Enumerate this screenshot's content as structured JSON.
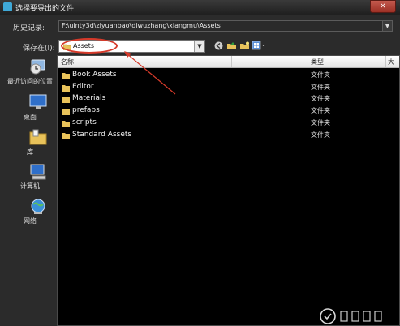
{
  "window": {
    "title": "选择要导出的文件",
    "close_symbol": "×"
  },
  "history": {
    "label": "历史记录:",
    "value": "F:\\uinty3d\\ziyuanbao\\diwuzhang\\xiangmu\\Assets"
  },
  "save_in": {
    "label": "保存在(I):",
    "value": "Assets"
  },
  "places": [
    {
      "label": "最近访问的位置",
      "icon": "recent-places-icon"
    },
    {
      "label": "桌面",
      "icon": "desktop-icon"
    },
    {
      "label": "库",
      "icon": "library-icon"
    },
    {
      "label": "计算机",
      "icon": "computer-icon"
    },
    {
      "label": "网络",
      "icon": "network-icon"
    }
  ],
  "columns": {
    "name": "名称",
    "type": "类型",
    "more": "大"
  },
  "files": [
    {
      "name": "Book Assets",
      "type": "文件夹"
    },
    {
      "name": "Editor",
      "type": "文件夹"
    },
    {
      "name": "Materials",
      "type": "文件夹"
    },
    {
      "name": "prefabs",
      "type": "文件夹"
    },
    {
      "name": "scripts",
      "type": "文件夹"
    },
    {
      "name": "Standard Assets",
      "type": "文件夹"
    }
  ],
  "annotation_color": "#d63a2a",
  "folder_color": "#e8c25a"
}
